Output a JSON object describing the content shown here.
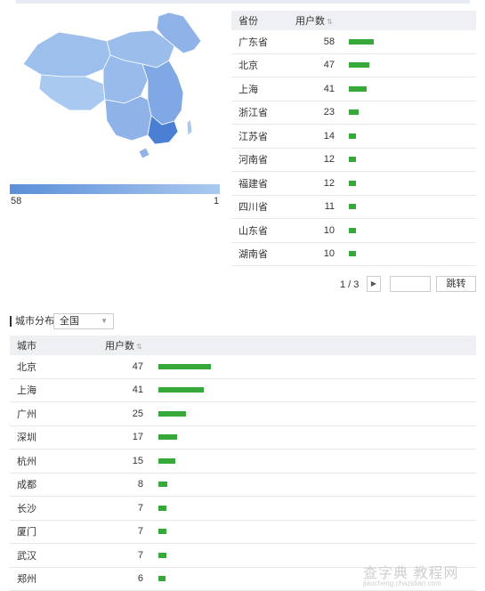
{
  "map": {
    "legend_min": "58",
    "legend_max": "1"
  },
  "province_table": {
    "headers": {
      "name": "省份",
      "count": "用户数"
    },
    "max": 58,
    "rows": [
      {
        "name": "广东省",
        "count": 58
      },
      {
        "name": "北京",
        "count": 47
      },
      {
        "name": "上海",
        "count": 41
      },
      {
        "name": "浙江省",
        "count": 23
      },
      {
        "name": "江苏省",
        "count": 14
      },
      {
        "name": "河南省",
        "count": 12
      },
      {
        "name": "福建省",
        "count": 12
      },
      {
        "name": "四川省",
        "count": 11
      },
      {
        "name": "山东省",
        "count": 10
      },
      {
        "name": "湖南省",
        "count": 10
      }
    ]
  },
  "pager": {
    "info": "1 / 3",
    "jump_label": "跳转"
  },
  "city_section": {
    "label": "城市分布",
    "select_value": "全国"
  },
  "city_table": {
    "headers": {
      "name": "城市",
      "count": "用户数"
    },
    "max": 47,
    "rows": [
      {
        "name": "北京",
        "count": 47
      },
      {
        "name": "上海",
        "count": 41
      },
      {
        "name": "广州",
        "count": 25
      },
      {
        "name": "深圳",
        "count": 17
      },
      {
        "name": "杭州",
        "count": 15
      },
      {
        "name": "成都",
        "count": 8
      },
      {
        "name": "长沙",
        "count": 7
      },
      {
        "name": "厦门",
        "count": 7
      },
      {
        "name": "武汉",
        "count": 7
      },
      {
        "name": "郑州",
        "count": 6
      }
    ]
  },
  "watermark": {
    "main": "查字典 教程网",
    "sub": "jiaocheng.chazidian.com"
  },
  "colors": {
    "bar": "#36a93a",
    "map_dark": "#5b8fd8",
    "map_light": "#a9c9f0"
  }
}
